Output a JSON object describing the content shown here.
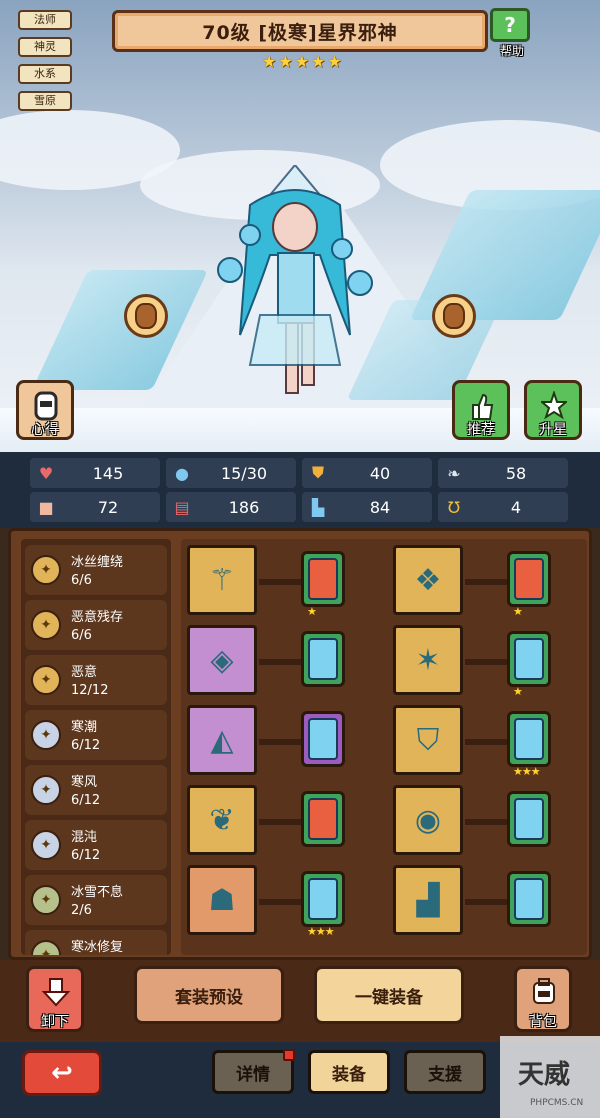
{
  "tags": [
    "法师",
    "神灵",
    "水系",
    "雪原"
  ],
  "title": "70级 [极寒]星界邪神",
  "star_count": 5,
  "help_label": "帮助",
  "left_button_label": "心得",
  "recommend_label": "推荐",
  "upstar_label": "升星",
  "stats": [
    {
      "icon": "heart-icon",
      "value": "145"
    },
    {
      "icon": "water-drop-icon",
      "value": "15/30"
    },
    {
      "icon": "shield-icon",
      "value": "40"
    },
    {
      "icon": "wing-icon",
      "value": "58"
    },
    {
      "icon": "fist-icon",
      "value": "72"
    },
    {
      "icon": "book-icon",
      "value": "186"
    },
    {
      "icon": "boot-icon",
      "value": "84"
    },
    {
      "icon": "horseshoe-icon",
      "value": "4"
    }
  ],
  "sets": [
    {
      "name": "冰丝缠绕",
      "count": "6/6",
      "color": "#e2b45a"
    },
    {
      "name": "恶意残存",
      "count": "6/6",
      "color": "#e2b45a"
    },
    {
      "name": "恶意",
      "count": "12/12",
      "color": "#e2b45a"
    },
    {
      "name": "寒潮",
      "count": "6/12",
      "color": "#c9d3e6"
    },
    {
      "name": "寒风",
      "count": "6/12",
      "color": "#c9d3e6"
    },
    {
      "name": "混沌",
      "count": "6/12",
      "color": "#c9d3e6"
    },
    {
      "name": "冰雪不息",
      "count": "2/6",
      "color": "#b6c08a"
    },
    {
      "name": "寒冰修复",
      "count": "",
      "color": "#b6c08a"
    }
  ],
  "equip_rows": [
    {
      "left_frame": "gold",
      "left_gem": "green",
      "left_core": "red",
      "left_stars": "★",
      "right_frame": "gold",
      "right_gem": "green",
      "right_core": "red",
      "right_stars": "★"
    },
    {
      "left_frame": "purple",
      "left_gem": "green",
      "left_core": "blue",
      "left_stars": "",
      "right_frame": "gold",
      "right_gem": "green",
      "right_core": "blue",
      "right_stars": "★"
    },
    {
      "left_frame": "purple",
      "left_gem": "purple",
      "left_core": "blue",
      "left_stars": "",
      "right_frame": "gold",
      "right_gem": "green",
      "right_core": "blue",
      "right_stars": "★★★"
    },
    {
      "left_frame": "gold",
      "left_gem": "green",
      "left_core": "red",
      "left_stars": "",
      "right_frame": "gold",
      "right_gem": "green",
      "right_core": "blue",
      "right_stars": ""
    },
    {
      "left_frame": "orange",
      "left_gem": "green",
      "left_core": "blue",
      "left_stars": "★★★",
      "right_frame": "gold",
      "right_gem": "green",
      "right_core": "blue",
      "right_stars": ""
    }
  ],
  "actions": {
    "unload_label": "卸下",
    "preset_label": "套装预设",
    "equip_all_label": "一键装备",
    "bag_label": "背包"
  },
  "tabs": [
    "详情",
    "装备",
    "支援"
  ],
  "active_tab": "装备",
  "watermark": {
    "big": "天威",
    "small": "PHPCMS.CN"
  }
}
